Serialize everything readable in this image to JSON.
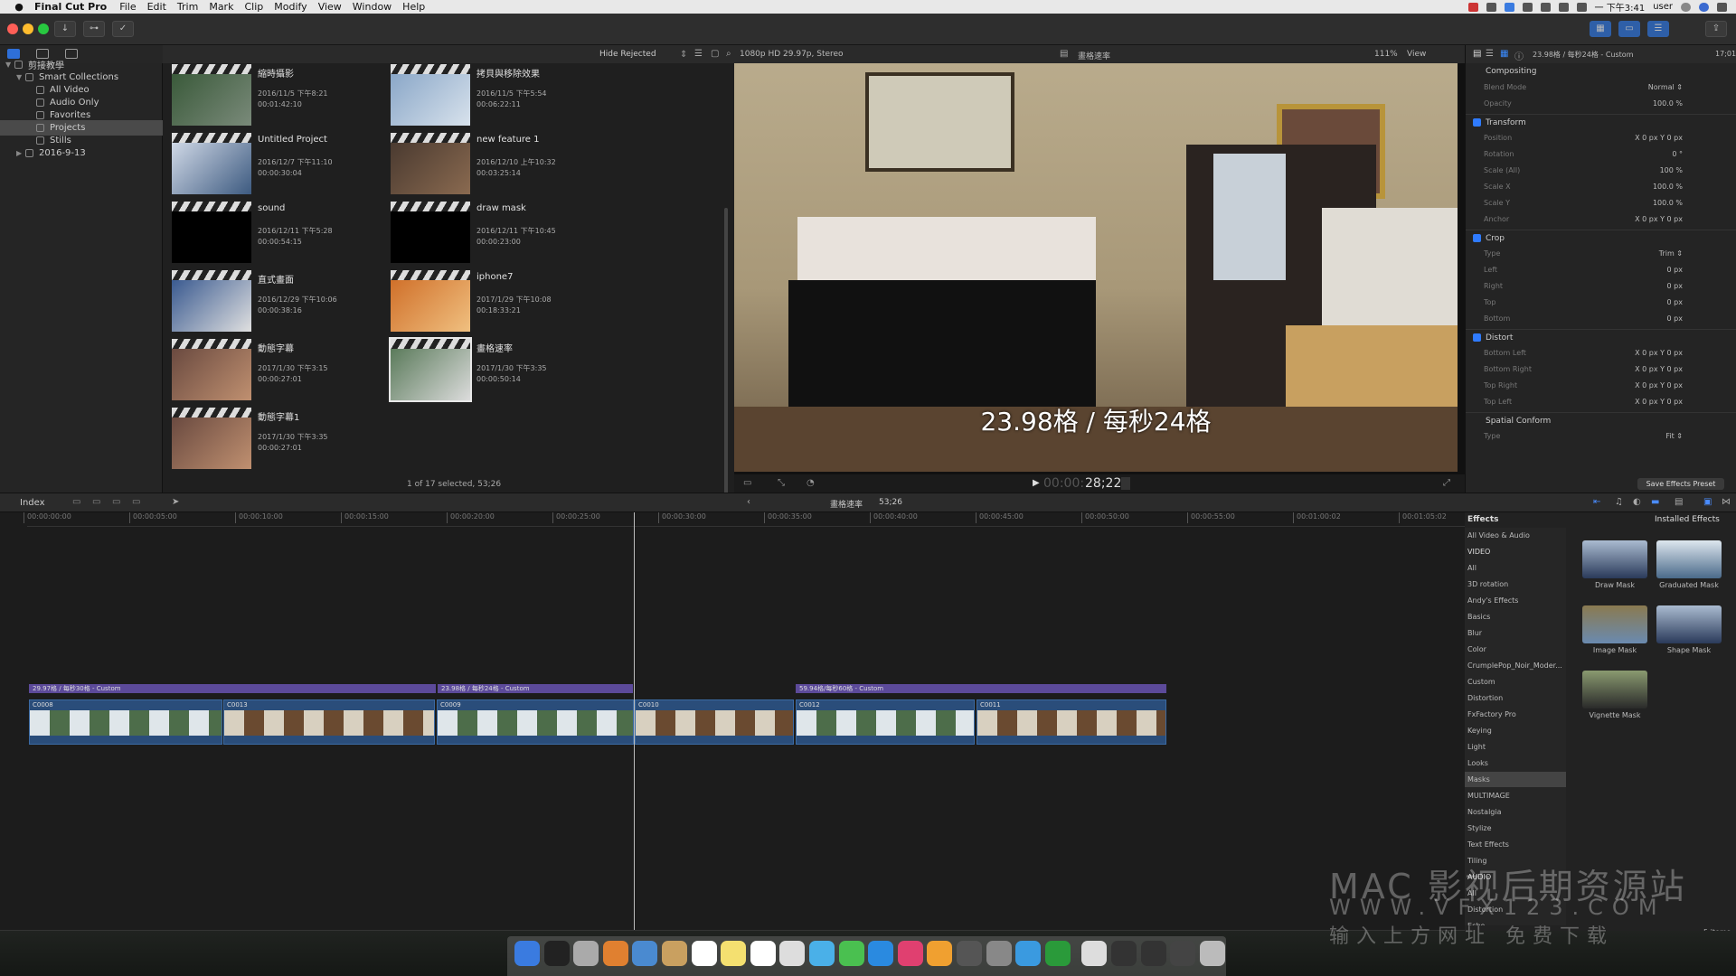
{
  "menubar": {
    "app": "Final Cut Pro",
    "items": [
      "File",
      "Edit",
      "Trim",
      "Mark",
      "Clip",
      "Modify",
      "View",
      "Window",
      "Help"
    ],
    "clock": "一 下午3:41",
    "user": "user"
  },
  "library": {
    "items": [
      {
        "label": "剪接教學",
        "level": 0,
        "expanded": true
      },
      {
        "label": "Smart Collections",
        "level": 1,
        "expanded": true
      },
      {
        "label": "All Video",
        "level": 2
      },
      {
        "label": "Audio Only",
        "level": 2
      },
      {
        "label": "Favorites",
        "level": 2
      },
      {
        "label": "Projects",
        "level": 2,
        "selected": true
      },
      {
        "label": "Stills",
        "level": 2
      },
      {
        "label": "2016-9-13",
        "level": 1,
        "expanded": false
      }
    ]
  },
  "browser": {
    "filter": "Hide Rejected",
    "clips": [
      {
        "title": "縮時攝影",
        "date": "2016/11/5 下午8:21",
        "dur": "00:01:42:10",
        "colors": [
          "#3a5a3a",
          "#7a8a7a"
        ]
      },
      {
        "title": "拷貝與移除效果",
        "date": "2016/11/5 下午5:54",
        "dur": "00:06:22:11",
        "colors": [
          "#8aa7c8",
          "#d8e2ec"
        ]
      },
      {
        "title": "Untitled Project",
        "date": "2016/12/7 下午11:10",
        "dur": "00:00:30:04",
        "colors": [
          "#cfd8e6",
          "#3d5a80"
        ]
      },
      {
        "title": "new feature 1",
        "date": "2016/12/10 上午10:32",
        "dur": "00:03:25:14",
        "colors": [
          "#4a3a30",
          "#8a6a50"
        ]
      },
      {
        "title": "sound",
        "date": "2016/12/11 下午5:28",
        "dur": "00:00:54:15",
        "colors": [
          "#000000",
          "#000000"
        ]
      },
      {
        "title": "draw mask",
        "date": "2016/12/11 下午10:45",
        "dur": "00:00:23:00",
        "colors": [
          "#000000",
          "#000000"
        ]
      },
      {
        "title": "直式畫面",
        "date": "2016/12/29 下午10:06",
        "dur": "00:00:38:16",
        "colors": [
          "#3a5a90",
          "#e0e0e0"
        ]
      },
      {
        "title": "iphone7",
        "date": "2017/1/29 下午10:08",
        "dur": "00:18:33:21",
        "colors": [
          "#d0702a",
          "#f0c080"
        ]
      },
      {
        "title": "動態字幕",
        "date": "2017/1/30 下午3:15",
        "dur": "00:00:27:01",
        "colors": [
          "#6a4a40",
          "#c09070"
        ]
      },
      {
        "title": "畫格速率",
        "date": "2017/1/30 下午3:35",
        "dur": "00:00:50:14",
        "colors": [
          "#5a7a5a",
          "#dcdcdc"
        ],
        "selected": true
      },
      {
        "title": "動態字幕1",
        "date": "2017/1/30 下午3:35",
        "dur": "00:00:27:01",
        "colors": [
          "#6a4a40",
          "#c09070"
        ]
      }
    ],
    "footer": "1 of 17 selected, 53;26"
  },
  "viewer": {
    "format": "1080p HD 29.97p, Stereo",
    "project": "畫格速率",
    "zoom": "111%",
    "view_label": "View",
    "caption": "23.98格 / 每秒24格",
    "timecode_dim": "00:00:",
    "timecode": "28;22"
  },
  "inspector": {
    "title": "23.98格 / 每秒24格 - Custom",
    "time": "17;01",
    "rows": [
      {
        "label": "Compositing",
        "hdr": true,
        "check": false,
        "value": ""
      },
      {
        "label": "Blend Mode",
        "value": "Normal ⇕"
      },
      {
        "label": "Opacity",
        "value": "100.0 %"
      },
      {
        "label": "Transform",
        "hdr": true,
        "check": true,
        "value": ""
      },
      {
        "label": "Position",
        "value": "X    0 px    Y    0 px"
      },
      {
        "label": "Rotation",
        "value": "0 °"
      },
      {
        "label": "Scale (All)",
        "value": "100 %"
      },
      {
        "label": "Scale X",
        "value": "100.0 %"
      },
      {
        "label": "Scale Y",
        "value": "100.0 %"
      },
      {
        "label": "Anchor",
        "value": "X    0 px    Y    0 px"
      },
      {
        "label": "Crop",
        "hdr": true,
        "check": true,
        "value": ""
      },
      {
        "label": "Type",
        "value": "Trim ⇕"
      },
      {
        "label": "Left",
        "value": "0 px"
      },
      {
        "label": "Right",
        "value": "0 px"
      },
      {
        "label": "Top",
        "value": "0 px"
      },
      {
        "label": "Bottom",
        "value": "0 px"
      },
      {
        "label": "Distort",
        "hdr": true,
        "check": true,
        "value": ""
      },
      {
        "label": "Bottom Left",
        "value": "X    0 px    Y    0 px"
      },
      {
        "label": "Bottom Right",
        "value": "X    0 px    Y    0 px"
      },
      {
        "label": "Top Right",
        "value": "X    0 px    Y    0 px"
      },
      {
        "label": "Top Left",
        "value": "X    0 px    Y    0 px"
      },
      {
        "label": "Spatial Conform",
        "hdr": true,
        "check": false,
        "value": ""
      },
      {
        "label": "Type",
        "value": "Fit ⇕"
      }
    ],
    "save_btn": "Save Effects Preset"
  },
  "timeline": {
    "index_label": "Index",
    "project": "畫格速率",
    "duration": "53;26",
    "ticks": [
      "00:00:00:00",
      "00:00:05:00",
      "00:00:10:00",
      "00:00:15:00",
      "00:00:20:00",
      "00:00:25:00",
      "00:00:30:00",
      "00:00:35:00",
      "00:00:40:00",
      "00:00:45:00",
      "00:00:50:00",
      "00:00:55:00",
      "00:01:00:02",
      "00:01:05:02"
    ],
    "storylines": [
      {
        "label": "29.97格 / 每秒30格 - Custom"
      },
      {
        "label": "23.98格 / 每秒24格 - Custom"
      },
      {
        "label": "59.94格/每秒60格 - Custom"
      }
    ],
    "clips": [
      {
        "name": "C0008",
        "colors": [
          "#dfe6ea",
          "#4d6d4a"
        ]
      },
      {
        "name": "C0013",
        "colors": [
          "#d8d0c0",
          "#6a4a30"
        ]
      },
      {
        "name": "C0009",
        "colors": [
          "#dfe6ea",
          "#4d6d4a"
        ]
      },
      {
        "name": "C0010",
        "colors": [
          "#d8d0c0",
          "#6a4a30"
        ]
      },
      {
        "name": "C0012",
        "colors": [
          "#dfe6ea",
          "#4d6d4a"
        ]
      },
      {
        "name": "C0011",
        "colors": [
          "#d8d0c0",
          "#6a4a30"
        ]
      }
    ]
  },
  "effects": {
    "header": "Effects",
    "installed": "Installed Effects",
    "categories": [
      "All Video & Audio",
      "VIDEO",
      "All",
      "3D rotation",
      "Andy's Effects",
      "Basics",
      "Blur",
      "Color",
      "CrumplePop_Noir_Moder...",
      "Custom",
      "Distortion",
      "FxFactory Pro",
      "Keying",
      "Light",
      "Looks",
      "Masks",
      "MULTIMAGE",
      "Nostalgia",
      "Stylize",
      "Text Effects",
      "Tiling",
      "AUDIO",
      "All",
      "Distortion",
      "Echo"
    ],
    "selected": "Masks",
    "items": [
      {
        "label": "Draw Mask",
        "colors": [
          "#2a3a5a",
          "#aabbd0"
        ]
      },
      {
        "label": "Graduated Mask",
        "colors": [
          "#4a6a8a",
          "#dde6ee"
        ]
      },
      {
        "label": "Image Mask",
        "colors": [
          "#6a8ab0",
          "#8a7a50"
        ]
      },
      {
        "label": "Shape Mask",
        "colors": [
          "#2a3a5a",
          "#aabbd0"
        ]
      },
      {
        "label": "Vignette Mask",
        "colors": [
          "#2a2a2a",
          "#8a9a70"
        ]
      }
    ],
    "count": "5 items"
  },
  "watermark": {
    "line1": "MAC 影视后期资源站",
    "line2": "WWW.VFX123.COM",
    "line3": "输入上方网址 免费下载"
  }
}
